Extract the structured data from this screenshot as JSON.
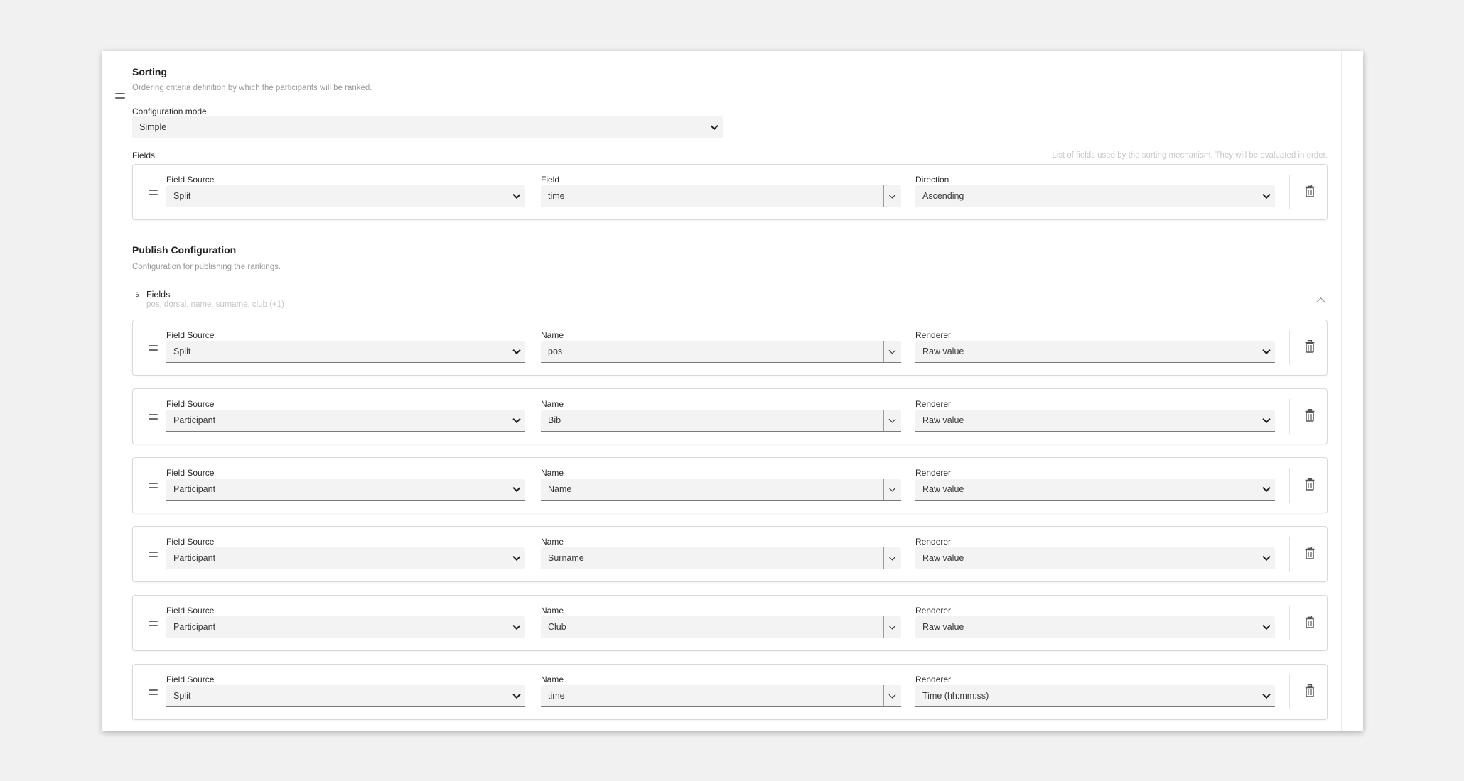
{
  "sorting": {
    "title": "Sorting",
    "description": "Ordering criteria definition by which the participants will be ranked.",
    "config_mode_label": "Configuration mode",
    "config_mode_value": "Simple",
    "fields_label": "Fields",
    "fields_hint": "List of fields used by the sorting mechanism. They will be evaluated in order.",
    "rows": [
      {
        "source_label": "Field Source",
        "source_value": "Split",
        "field_label": "Field",
        "field_value": "time",
        "direction_label": "Direction",
        "direction_value": "Ascending"
      }
    ]
  },
  "publish": {
    "title": "Publish Configuration",
    "description": "Configuration for publishing the rankings.",
    "group": {
      "count": "6",
      "name": "Fields",
      "summary": "pos, dorsal, name, surname, club (+1)"
    },
    "rows": [
      {
        "source_label": "Field Source",
        "source_value": "Split",
        "name_label": "Name",
        "name_value": "pos",
        "renderer_label": "Renderer",
        "renderer_value": "Raw value"
      },
      {
        "source_label": "Field Source",
        "source_value": "Participant",
        "name_label": "Name",
        "name_value": "Bib",
        "renderer_label": "Renderer",
        "renderer_value": "Raw value"
      },
      {
        "source_label": "Field Source",
        "source_value": "Participant",
        "name_label": "Name",
        "name_value": "Name",
        "renderer_label": "Renderer",
        "renderer_value": "Raw value"
      },
      {
        "source_label": "Field Source",
        "source_value": "Participant",
        "name_label": "Name",
        "name_value": "Surname",
        "renderer_label": "Renderer",
        "renderer_value": "Raw value"
      },
      {
        "source_label": "Field Source",
        "source_value": "Participant",
        "name_label": "Name",
        "name_value": "Club",
        "renderer_label": "Renderer",
        "renderer_value": "Raw value"
      },
      {
        "source_label": "Field Source",
        "source_value": "Split",
        "name_label": "Name",
        "name_value": "time",
        "renderer_label": "Renderer",
        "renderer_value": "Time (hh:mm:ss)"
      }
    ]
  },
  "icons": {
    "drag_handle": "drag-handle-icon",
    "delete": "trash-icon",
    "dropdown": "chevron-down-icon",
    "collapse": "chevron-up-icon"
  }
}
